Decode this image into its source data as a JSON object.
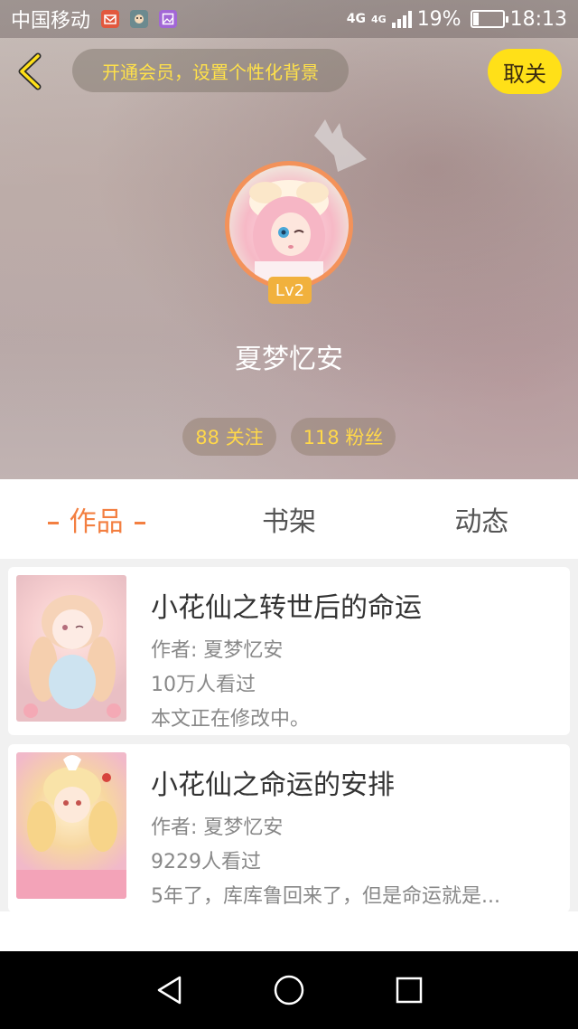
{
  "status_bar": {
    "carrier": "中国移动",
    "network": "4G",
    "network2": "4G",
    "battery": "19%",
    "time": "18:13",
    "battery_level": 0.19,
    "notification_icons": [
      "mail-icon",
      "app-icon",
      "gallery-icon"
    ]
  },
  "header": {
    "vip_banner": "开通会员，设置个性化背景",
    "unfollow_label": "取关",
    "level": "Lv2",
    "username": "夏梦忆安",
    "following": "88 关注",
    "fans": "118 粉丝"
  },
  "tabs": [
    {
      "label": "作品",
      "active": true
    },
    {
      "label": "书架",
      "active": false
    },
    {
      "label": "动态",
      "active": false
    }
  ],
  "books": [
    {
      "title": "小花仙之转世后的命运",
      "author": "作者: 夏梦忆安",
      "views": "10万人看过",
      "desc": "本文正在修改中。"
    },
    {
      "title": "小花仙之命运的安排",
      "author": "作者: 夏梦忆安",
      "views": "9229人看过",
      "desc": "5年了，库库鲁回来了，但是命运就是..."
    }
  ],
  "colors": {
    "accent": "#f37f41",
    "yellow": "#ffe018",
    "level_badge": "#f1b13d"
  }
}
